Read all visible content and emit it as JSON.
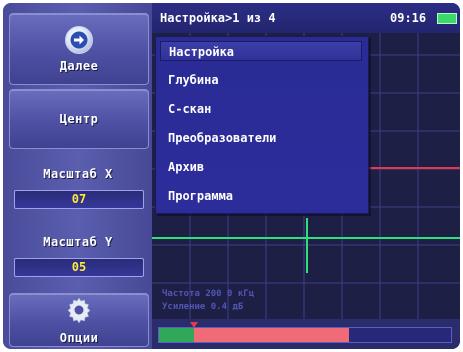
{
  "header": {
    "title": "Настройка>1 из 4",
    "clock": "09:16"
  },
  "sidebar": {
    "next_label": "Далее",
    "center_label": "Центр",
    "scale_x": {
      "label": "Масштаб X",
      "value": "07"
    },
    "scale_y": {
      "label": "Масштаб Y",
      "value": "05"
    },
    "options_label": "Опции"
  },
  "menu": {
    "items": [
      {
        "label": "Настройка"
      },
      {
        "label": "Глубина"
      },
      {
        "label": "С-скан"
      },
      {
        "label": "Преобразователи"
      },
      {
        "label": "Архив"
      },
      {
        "label": "Программа"
      }
    ],
    "selected_index": 0
  },
  "plot": {
    "readout_line1": "Частота   200 0 кГц",
    "readout_line2": "Усиление   0.4 дБ"
  },
  "gauge": {
    "green_fraction": 0.12,
    "red_fraction": 0.53
  },
  "colors": {
    "background": "#2b2d6e",
    "sidebar": "#5b5eaf",
    "menu": "#2a2b95",
    "value_text": "#ffe93a",
    "battery": "#3bd96a",
    "trace_red": "#e23a4a",
    "trace_green": "#2fe07a",
    "gauge_green": "#2fa85a",
    "gauge_red": "#f06a78"
  },
  "icons": {
    "next": "arrow-right-circle-icon",
    "options": "gear-icon",
    "battery": "battery-icon"
  }
}
